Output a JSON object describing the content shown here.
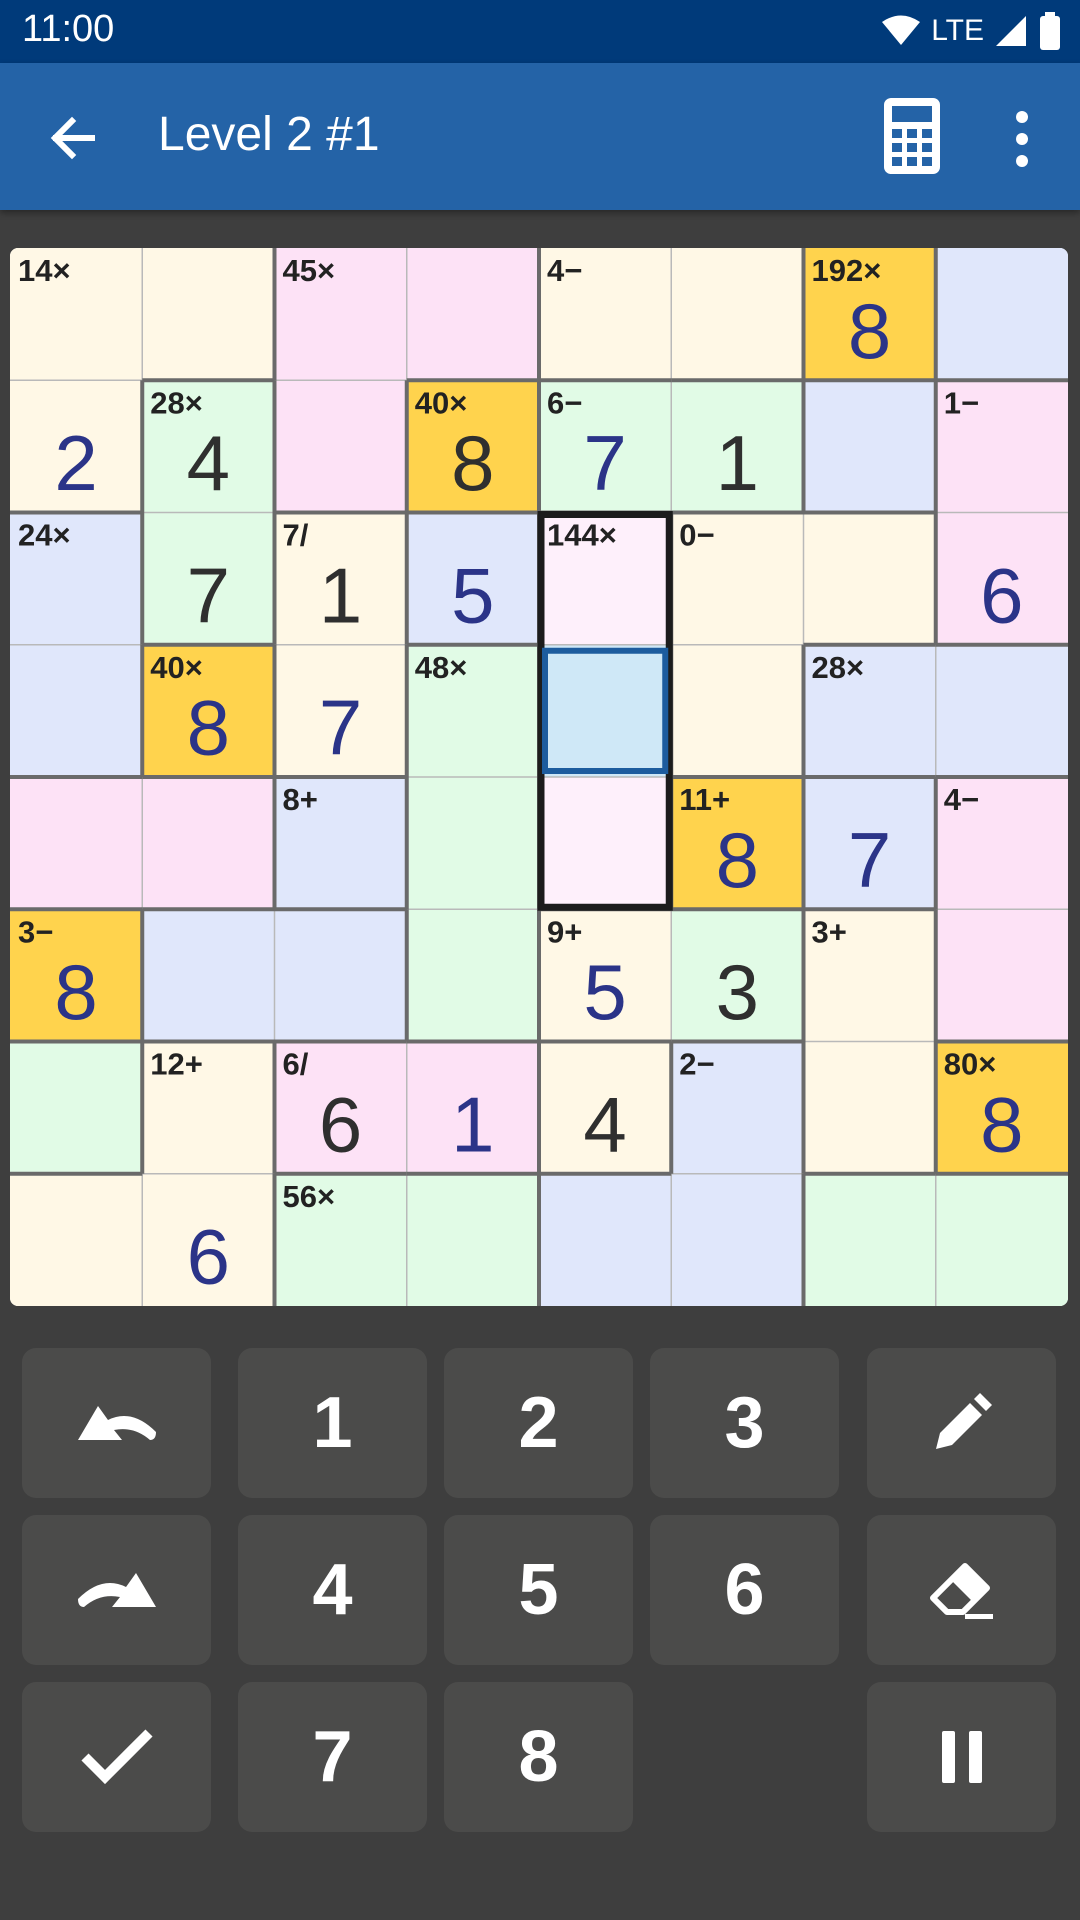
{
  "status_bar": {
    "time": "11:00",
    "network": "LTE"
  },
  "app_bar": {
    "title": "Level 2 #1",
    "back_icon": "arrow-left-icon",
    "calculator_icon": "calculator-icon",
    "menu_icon": "more-vertical-icon"
  },
  "palette": {
    "Y": "#fff8e6",
    "P": "#fde2f6",
    "L": "#e0e7fb",
    "G": "#e1fbe6",
    "O": "#ffd34d",
    "S": "#fef0fb",
    "B": "#cfe8f7"
  },
  "board": {
    "size": 8,
    "colors": [
      [
        "Y",
        "Y",
        "P",
        "P",
        "Y",
        "Y",
        "O",
        "L"
      ],
      [
        "Y",
        "G",
        "P",
        "O",
        "G",
        "G",
        "L",
        "P"
      ],
      [
        "L",
        "G",
        "Y",
        "L",
        "S",
        "Y",
        "Y",
        "P"
      ],
      [
        "L",
        "O",
        "Y",
        "G",
        "B",
        "Y",
        "L",
        "L"
      ],
      [
        "P",
        "P",
        "L",
        "G",
        "S",
        "O",
        "L",
        "P"
      ],
      [
        "O",
        "L",
        "L",
        "G",
        "Y",
        "G",
        "Y",
        "P"
      ],
      [
        "G",
        "Y",
        "P",
        "P",
        "Y",
        "L",
        "Y",
        "O"
      ],
      [
        "Y",
        "Y",
        "G",
        "G",
        "L",
        "L",
        "G",
        "G"
      ]
    ],
    "cages": [
      [
        "a",
        "a",
        "b",
        "b",
        "c",
        "c",
        "d",
        "e"
      ],
      [
        "a",
        "f",
        "b",
        "g",
        "h",
        "h",
        "e",
        "i"
      ],
      [
        "j",
        "f",
        "k",
        "l",
        "m",
        "n",
        "n",
        "i"
      ],
      [
        "j",
        "o",
        "k",
        "p",
        "m",
        "n",
        "q",
        "q"
      ],
      [
        "r",
        "r",
        "s",
        "p",
        "m",
        "t",
        "u",
        "v"
      ],
      [
        "w",
        "x",
        "x",
        "p",
        "y",
        "y",
        "z",
        "v"
      ],
      [
        "A",
        "B",
        "C",
        "C",
        "B",
        "D",
        "z",
        "E"
      ],
      [
        "B",
        "B",
        "F",
        "F",
        "D",
        "D",
        "F",
        "F"
      ]
    ],
    "clues": [
      {
        "row": 0,
        "col": 0,
        "text": "14×"
      },
      {
        "row": 0,
        "col": 2,
        "text": "45×"
      },
      {
        "row": 0,
        "col": 4,
        "text": "4−"
      },
      {
        "row": 0,
        "col": 6,
        "text": "192×"
      },
      {
        "row": 1,
        "col": 1,
        "text": "28×"
      },
      {
        "row": 1,
        "col": 3,
        "text": "40×"
      },
      {
        "row": 1,
        "col": 4,
        "text": "6−"
      },
      {
        "row": 1,
        "col": 7,
        "text": "1−"
      },
      {
        "row": 2,
        "col": 0,
        "text": "24×"
      },
      {
        "row": 2,
        "col": 2,
        "text": "7/"
      },
      {
        "row": 2,
        "col": 4,
        "text": "144×"
      },
      {
        "row": 2,
        "col": 5,
        "text": "0−"
      },
      {
        "row": 3,
        "col": 1,
        "text": "40×"
      },
      {
        "row": 3,
        "col": 3,
        "text": "48×"
      },
      {
        "row": 3,
        "col": 6,
        "text": "28×"
      },
      {
        "row": 4,
        "col": 2,
        "text": "8+"
      },
      {
        "row": 4,
        "col": 5,
        "text": "11+"
      },
      {
        "row": 4,
        "col": 7,
        "text": "4−"
      },
      {
        "row": 5,
        "col": 0,
        "text": "3−"
      },
      {
        "row": 5,
        "col": 4,
        "text": "9+"
      },
      {
        "row": 5,
        "col": 6,
        "text": "3+"
      },
      {
        "row": 6,
        "col": 1,
        "text": "12+"
      },
      {
        "row": 6,
        "col": 2,
        "text": "6/"
      },
      {
        "row": 6,
        "col": 5,
        "text": "2−"
      },
      {
        "row": 6,
        "col": 7,
        "text": "80×"
      },
      {
        "row": 7,
        "col": 2,
        "text": "56×"
      }
    ],
    "values": [
      {
        "row": 0,
        "col": 6,
        "value": "8",
        "kind": "entered"
      },
      {
        "row": 1,
        "col": 0,
        "value": "2",
        "kind": "entered"
      },
      {
        "row": 1,
        "col": 1,
        "value": "4",
        "kind": "given"
      },
      {
        "row": 1,
        "col": 3,
        "value": "8",
        "kind": "given"
      },
      {
        "row": 1,
        "col": 4,
        "value": "7",
        "kind": "entered"
      },
      {
        "row": 1,
        "col": 5,
        "value": "1",
        "kind": "given"
      },
      {
        "row": 2,
        "col": 1,
        "value": "7",
        "kind": "given"
      },
      {
        "row": 2,
        "col": 2,
        "value": "1",
        "kind": "given"
      },
      {
        "row": 2,
        "col": 3,
        "value": "5",
        "kind": "entered"
      },
      {
        "row": 2,
        "col": 7,
        "value": "6",
        "kind": "entered"
      },
      {
        "row": 3,
        "col": 1,
        "value": "8",
        "kind": "entered"
      },
      {
        "row": 3,
        "col": 2,
        "value": "7",
        "kind": "entered"
      },
      {
        "row": 4,
        "col": 5,
        "value": "8",
        "kind": "entered"
      },
      {
        "row": 4,
        "col": 6,
        "value": "7",
        "kind": "entered"
      },
      {
        "row": 5,
        "col": 0,
        "value": "8",
        "kind": "entered"
      },
      {
        "row": 5,
        "col": 4,
        "value": "5",
        "kind": "entered"
      },
      {
        "row": 5,
        "col": 5,
        "value": "3",
        "kind": "given"
      },
      {
        "row": 6,
        "col": 2,
        "value": "6",
        "kind": "given"
      },
      {
        "row": 6,
        "col": 3,
        "value": "1",
        "kind": "entered"
      },
      {
        "row": 6,
        "col": 4,
        "value": "4",
        "kind": "given"
      },
      {
        "row": 6,
        "col": 7,
        "value": "8",
        "kind": "entered"
      },
      {
        "row": 7,
        "col": 1,
        "value": "6",
        "kind": "entered"
      }
    ],
    "selected_cage": {
      "col": 4,
      "row_start": 2,
      "row_end": 4
    },
    "selected_cell": {
      "row": 3,
      "col": 4
    },
    "ink": {
      "entered": "#2b3488",
      "given": "#2f2f2f",
      "clue": "#222222"
    }
  },
  "keypad": {
    "digits": [
      "1",
      "2",
      "3",
      "4",
      "5",
      "6",
      "7",
      "8"
    ],
    "undo_icon": "undo-icon",
    "redo_icon": "redo-icon",
    "check_icon": "check-icon",
    "pencil_icon": "pencil-icon",
    "eraser_icon": "eraser-icon",
    "pause_icon": "pause-icon"
  }
}
